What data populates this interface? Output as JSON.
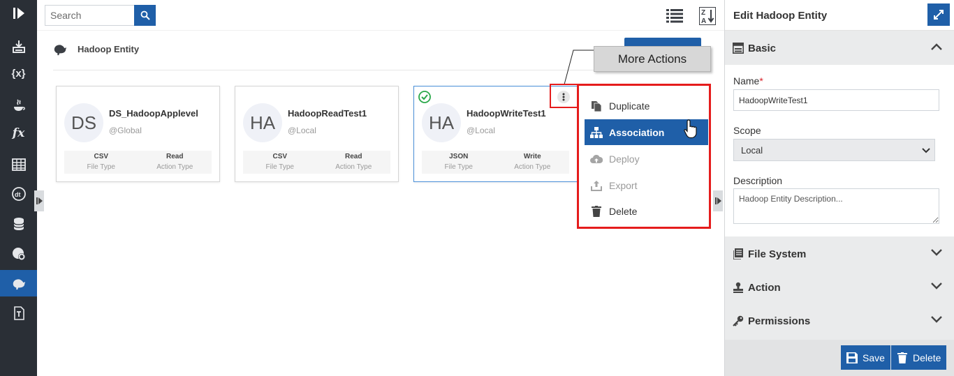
{
  "sidebar": {
    "items": [
      {
        "icon": "play-logo-icon"
      },
      {
        "icon": "import-icon"
      },
      {
        "icon": "variables-icon",
        "text": "{x}"
      },
      {
        "icon": "java-icon"
      },
      {
        "icon": "function-icon",
        "text": "fx"
      },
      {
        "icon": "table-icon"
      },
      {
        "icon": "datatype-icon"
      },
      {
        "icon": "database-icon"
      },
      {
        "icon": "settings-globe-icon"
      },
      {
        "icon": "hadoop-icon",
        "active": true
      },
      {
        "icon": "text-template-icon"
      }
    ]
  },
  "toolbar": {
    "search_placeholder": "Search",
    "search_icon": "search-icon",
    "list_view_icon": "list-view-icon",
    "sort_icon": "sort-za-icon"
  },
  "page": {
    "heading": "Hadoop Entity",
    "heading_icon": "hadoop-icon"
  },
  "cards": [
    {
      "initials": "DS",
      "title": "DS_HadoopApplevel",
      "scope": "@Global",
      "file_type": "CSV",
      "file_type_label": "File Type",
      "action_type": "Read",
      "action_type_label": "Action Type",
      "selected": false
    },
    {
      "initials": "HA",
      "title": "HadoopReadTest1",
      "scope": "@Local",
      "file_type": "CSV",
      "file_type_label": "File Type",
      "action_type": "Read",
      "action_type_label": "Action Type",
      "selected": false
    },
    {
      "initials": "HA",
      "title": "HadoopWriteTest1",
      "scope": "@Local",
      "file_type": "JSON",
      "file_type_label": "File Type",
      "action_type": "Write",
      "action_type_label": "Action Type",
      "selected": true
    }
  ],
  "more_actions": {
    "callout": "More Actions",
    "items": [
      {
        "label": "Duplicate",
        "icon": "duplicate-icon",
        "state": "normal"
      },
      {
        "label": "Association",
        "icon": "association-icon",
        "state": "active"
      },
      {
        "label": "Deploy",
        "icon": "cloud-upload-icon",
        "state": "disabled"
      },
      {
        "label": "Export",
        "icon": "export-icon",
        "state": "disabled"
      },
      {
        "label": "Delete",
        "icon": "trash-icon",
        "state": "normal"
      }
    ]
  },
  "edit_panel": {
    "title": "Edit Hadoop Entity",
    "sections": {
      "basic": "Basic",
      "file_system": "File System",
      "action": "Action",
      "permissions": "Permissions"
    },
    "fields": {
      "name_label": "Name",
      "name_required": "*",
      "name_value": "HadoopWriteTest1",
      "scope_label": "Scope",
      "scope_value": "Local",
      "description_label": "Description",
      "description_placeholder": "Hadoop Entity Description..."
    },
    "buttons": {
      "save": "Save",
      "delete": "Delete"
    }
  },
  "colors": {
    "primary": "#1f5fa8",
    "rail": "#2a2f36",
    "highlight": "#e51c1c",
    "success": "#2aa84a"
  }
}
